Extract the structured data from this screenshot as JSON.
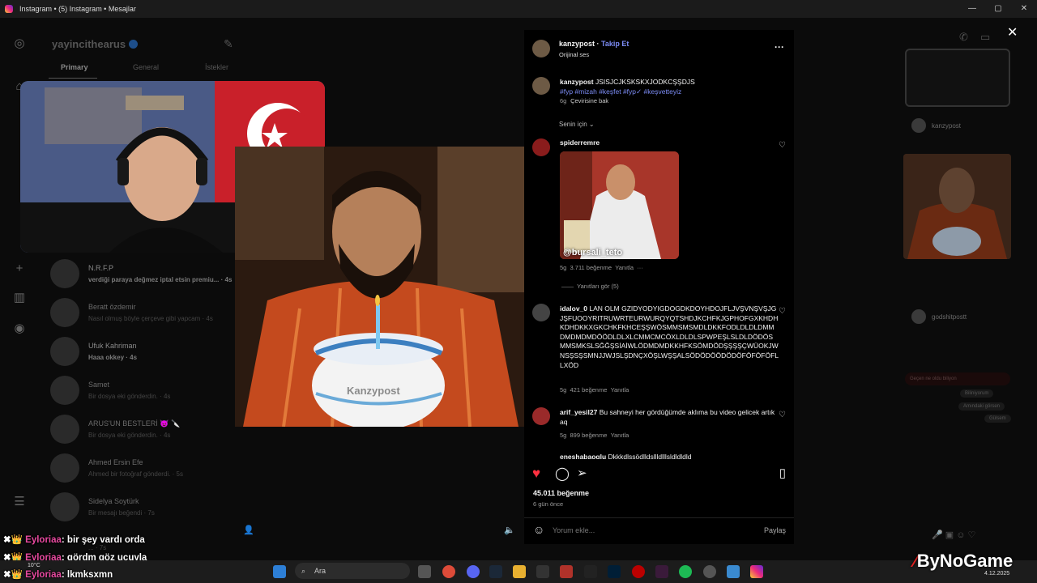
{
  "window": {
    "title": "Instagram • (5) Instagram • Mesajlar",
    "controls": [
      "—",
      "▢",
      "✕"
    ]
  },
  "sidebar": {
    "username": "yayincithearus",
    "tabs": [
      "Primary",
      "General",
      "İstekler"
    ],
    "conversations": [
      {
        "name": "N.R.F.P",
        "message": "verdiği paraya değmez iptal etsin premiu... · 4s",
        "active": true
      },
      {
        "name": "Beratt özdemir",
        "message": "Nasıl olmuş böyle çerçeve gibi yapcam · 4s"
      },
      {
        "name": "Ufuk Kahriman",
        "message": "Haaa okkey · 4s",
        "active": true
      },
      {
        "name": "Samet",
        "message": "Bir dosya eki gönderdin. · 4s"
      },
      {
        "name": "ARUS'UN BESTLERİ 😈 🔪",
        "message": "Bir dosya eki gönderdin. · 4s"
      },
      {
        "name": "Ahmed Ersin Efe",
        "message": "Ahmed bir fotoğraf gönderdi. · 5s"
      },
      {
        "name": "Sidelya Soytürk",
        "message": "Bir mesajı beğendi · 7s"
      },
      {
        "name": "",
        "message": "... · 7s"
      }
    ]
  },
  "video": {
    "cake_text": "Kanzypost"
  },
  "post": {
    "author": "kanzypost",
    "follow": "Takip Et",
    "audio": "Orijinal ses",
    "more": "···",
    "caption_author": "kanzypost",
    "caption": "JSISJCJKSKSKXJODKCŞŞDJS",
    "caption_tags": "#fyp #mizah #keşfet #fyp✓ #keşvetteyiz",
    "caption_time": "6g",
    "translate": "Çevirisine bak",
    "filter": "Senin için",
    "comments": [
      {
        "user": "spiderremre",
        "text": "",
        "gif_label": "@bursali_teto",
        "time": "5g",
        "likes": "3.711 beğenme",
        "reply": "Yanıtla",
        "view_replies": "Yanıtları gör (5)"
      },
      {
        "user": "idalov_0",
        "text": "LAN OLM GZIDYODYIGDOGDKDOYHDOJFLJVŞVNŞVŞJGJŞFUOOYRITRUWRTEURWURQYQTSHDJKCHFKJGPHOFGXKHDHKDHDKKXGKCHKFKHCEŞŞWÖSMMSMSMDLDKKFODLDLDLDMMDMDMDMDÖÖDLDLXLCMMCMCÖXLDLDLSPWPEŞLSLDLDÖDÖSMMSMKSLSĞĞŞSİAİWLÖDMDMDKKHFKSÖMDÖDŞŞŞŞÇWÜOKJWNSŞSŞSMNJJWJSLŞDNÇXÖŞLWŞŞALSÖDÖDÖÖDÖDÖFÖFÖFÖFLLXÖD",
        "time": "5g",
        "likes": "421 beğenme",
        "reply": "Yanıtla"
      },
      {
        "user": "arif_yesil27",
        "text": "Bu sahneyi her gördüğümde aklıma bu video gelicek artık aq",
        "time": "5g",
        "likes": "899 beğenme",
        "reply": "Yanıtla"
      },
      {
        "user": "eneshabaoglu",
        "text": "Dkkkdlssödlldsllldlllsldldldld"
      }
    ],
    "likes": "45.011 beğenme",
    "posted": "6 gün önce",
    "comment_placeholder": "Yorum ekle...",
    "share": "Paylaş",
    "like_color": "#ff3040"
  },
  "right_panel": {
    "items": [
      "kanzypost",
      "godshitpostt"
    ],
    "bubble": "Geçen ne oldu biliyon",
    "replies": [
      "Biliniyorum",
      "Amındaki görsen",
      "Gülsem"
    ]
  },
  "overlay_chat": [
    {
      "user": "Eyloriaa",
      "message": ": bir şey vardı orda"
    },
    {
      "user": "Eyloriaa",
      "message": ": gördm göz ucuyla"
    },
    {
      "user": "Eyloriaa",
      "message": ": lkmksxmn"
    }
  ],
  "taskbar": {
    "search": "Ara",
    "weather": "10°C",
    "date": "4.12.2025"
  },
  "watermark": "ByNoGame"
}
